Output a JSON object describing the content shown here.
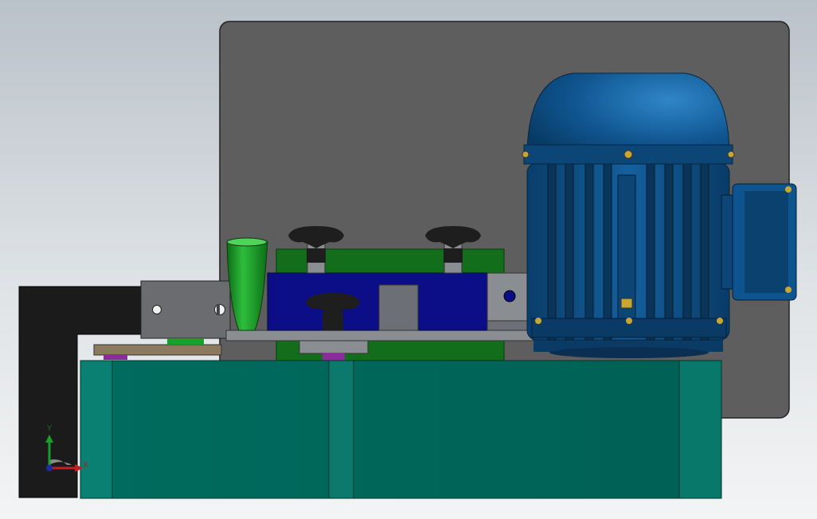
{
  "triad": {
    "y_label": "Y",
    "x_label": "X"
  },
  "colors": {
    "panel": "#5e5e5e",
    "tank": "#006b5e",
    "motor_blue": "#0d4f86",
    "valve_blue": "#0b0e86",
    "manifold_green": "#136e1c",
    "pipe_black": "#1b1b1b",
    "filler_green": "#1aa02a",
    "knob_black": "#1e1e1e",
    "plate_gray": "#8a8d92"
  }
}
